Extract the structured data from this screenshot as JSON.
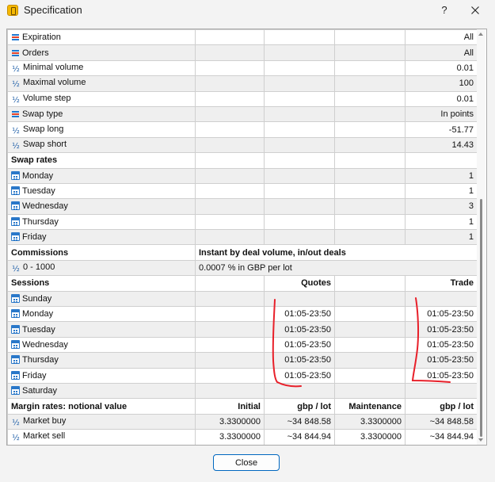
{
  "window": {
    "title": "Specification",
    "help": "?",
    "close_label": "Close"
  },
  "rows": [
    {
      "icon": "list-icon",
      "name": "Expiration",
      "c2": "",
      "c3": "",
      "c4": "",
      "c5": "All"
    },
    {
      "icon": "list-icon",
      "name": "Orders",
      "c2": "",
      "c3": "",
      "c4": "",
      "c5": "All"
    },
    {
      "icon": "half-icon",
      "name": "Minimal volume",
      "c2": "",
      "c3": "",
      "c4": "",
      "c5": "0.01"
    },
    {
      "icon": "half-icon",
      "name": "Maximal volume",
      "c2": "",
      "c3": "",
      "c4": "",
      "c5": "100"
    },
    {
      "icon": "half-icon",
      "name": "Volume step",
      "c2": "",
      "c3": "",
      "c4": "",
      "c5": "0.01"
    },
    {
      "icon": "list-icon",
      "name": "Swap type",
      "c2": "",
      "c3": "",
      "c4": "",
      "c5": "In points"
    },
    {
      "icon": "half-icon",
      "name": "Swap long",
      "c2": "",
      "c3": "",
      "c4": "",
      "c5": "-51.77"
    },
    {
      "icon": "half-icon",
      "name": "Swap short",
      "c2": "",
      "c3": "",
      "c4": "",
      "c5": "14.43"
    },
    {
      "icon": "",
      "name": "Swap rates",
      "bold": true,
      "c2": "",
      "c3": "",
      "c4": "",
      "c5": ""
    },
    {
      "icon": "calendar-icon",
      "name": "Monday",
      "c2": "",
      "c3": "",
      "c4": "",
      "c5": "1"
    },
    {
      "icon": "calendar-icon",
      "name": "Tuesday",
      "c2": "",
      "c3": "",
      "c4": "",
      "c5": "1"
    },
    {
      "icon": "calendar-icon",
      "name": "Wednesday",
      "c2": "",
      "c3": "",
      "c4": "",
      "c5": "3"
    },
    {
      "icon": "calendar-icon",
      "name": "Thursday",
      "c2": "",
      "c3": "",
      "c4": "",
      "c5": "1"
    },
    {
      "icon": "calendar-icon",
      "name": "Friday",
      "c2": "",
      "c3": "",
      "c4": "",
      "c5": "1"
    },
    {
      "icon": "",
      "name": "Commissions",
      "bold": true,
      "span": "Instant by deal volume, in/out deals",
      "spanBold": true
    },
    {
      "icon": "half-icon",
      "name": "0 - 1000",
      "span": "0.0007 % in GBP per lot"
    },
    {
      "icon": "",
      "name": "Sessions",
      "bold": true,
      "c2": "",
      "c3": "Quotes",
      "c4": "",
      "c5": "Trade",
      "headBold": true
    },
    {
      "icon": "calendar-icon",
      "name": "Sunday",
      "c2": "",
      "c3": "",
      "c4": "",
      "c5": ""
    },
    {
      "icon": "calendar-icon",
      "name": "Monday",
      "c2": "",
      "c3": "01:05-23:50",
      "c4": "",
      "c5": "01:05-23:50"
    },
    {
      "icon": "calendar-icon",
      "name": "Tuesday",
      "c2": "",
      "c3": "01:05-23:50",
      "c4": "",
      "c5": "01:05-23:50"
    },
    {
      "icon": "calendar-icon",
      "name": "Wednesday",
      "c2": "",
      "c3": "01:05-23:50",
      "c4": "",
      "c5": "01:05-23:50"
    },
    {
      "icon": "calendar-icon",
      "name": "Thursday",
      "c2": "",
      "c3": "01:05-23:50",
      "c4": "",
      "c5": "01:05-23:50"
    },
    {
      "icon": "calendar-icon",
      "name": "Friday",
      "c2": "",
      "c3": "01:05-23:50",
      "c4": "",
      "c5": "01:05-23:50"
    },
    {
      "icon": "calendar-icon",
      "name": "Saturday",
      "c2": "",
      "c3": "",
      "c4": "",
      "c5": ""
    },
    {
      "icon": "",
      "name": "Margin rates: notional value",
      "bold": true,
      "c2": "Initial",
      "c3": "gbp / lot",
      "c4": "Maintenance",
      "c5": "gbp / lot",
      "headBold": true
    },
    {
      "icon": "half-icon",
      "name": "Market buy",
      "c2": "3.3300000",
      "c3": "~34 848.58",
      "c4": "3.3300000",
      "c5": "~34 848.58"
    },
    {
      "icon": "half-icon",
      "name": "Market sell",
      "c2": "3.3300000",
      "c3": "~34 844.94",
      "c4": "3.3300000",
      "c5": "~34 844.94"
    }
  ],
  "colors": {
    "annotation": "#e8202a",
    "accent": "#0067c0"
  }
}
